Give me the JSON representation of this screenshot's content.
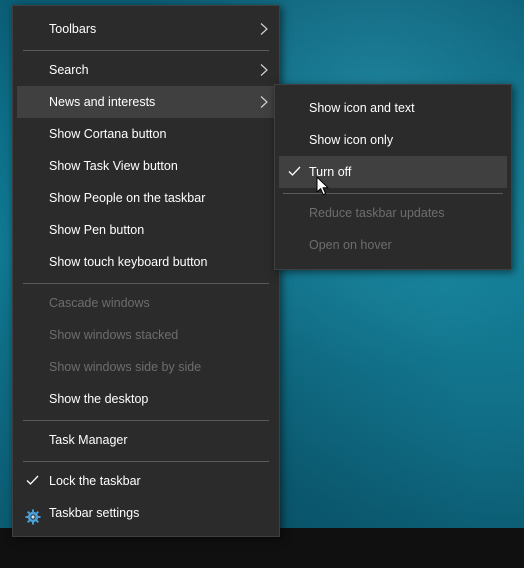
{
  "context_menu": {
    "items": [
      {
        "label": "Toolbars",
        "enabled": true,
        "has_submenu": true
      },
      {
        "label": "Search",
        "enabled": true,
        "has_submenu": true
      },
      {
        "label": "News and interests",
        "enabled": true,
        "has_submenu": true,
        "highlighted": true
      },
      {
        "label": "Show Cortana button",
        "enabled": true
      },
      {
        "label": "Show Task View button",
        "enabled": true
      },
      {
        "label": "Show People on the taskbar",
        "enabled": true
      },
      {
        "label": "Show Pen button",
        "enabled": true
      },
      {
        "label": "Show touch keyboard button",
        "enabled": true
      },
      {
        "label": "Cascade windows",
        "enabled": false
      },
      {
        "label": "Show windows stacked",
        "enabled": false
      },
      {
        "label": "Show windows side by side",
        "enabled": false
      },
      {
        "label": "Show the desktop",
        "enabled": true
      },
      {
        "label": "Task Manager",
        "enabled": true
      },
      {
        "label": "Lock the taskbar",
        "enabled": true,
        "checked": true
      },
      {
        "label": "Taskbar settings",
        "enabled": true,
        "icon": "gear-icon"
      }
    ]
  },
  "submenu": {
    "parent": "News and interests",
    "items": [
      {
        "label": "Show icon and text",
        "enabled": true
      },
      {
        "label": "Show icon only",
        "enabled": true
      },
      {
        "label": "Turn off",
        "enabled": true,
        "checked": true,
        "highlighted": true
      },
      {
        "label": "Reduce taskbar updates",
        "enabled": false
      },
      {
        "label": "Open on hover",
        "enabled": false
      }
    ]
  },
  "colors": {
    "menu_background": "#2b2b2b",
    "highlight": "#404040",
    "text": "#ffffff",
    "disabled_text": "#6d6d6d",
    "separator": "#5a5a5a",
    "desktop": "#0f6d85",
    "taskbar": "#101010",
    "gear_accent": "#4a9fd8"
  }
}
